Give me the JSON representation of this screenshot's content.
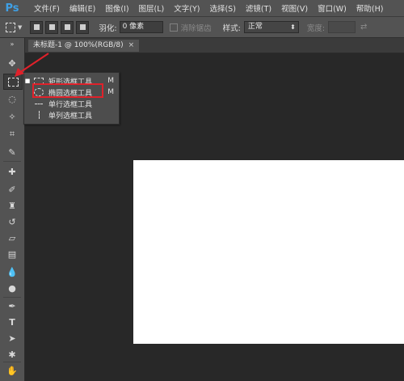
{
  "app": {
    "logo": "Ps",
    "menus": [
      "文件(F)",
      "编辑(E)",
      "图像(I)",
      "图层(L)",
      "文字(Y)",
      "选择(S)",
      "滤镜(T)",
      "视图(V)",
      "窗口(W)",
      "帮助(H)"
    ]
  },
  "options_bar": {
    "feather_label": "羽化:",
    "feather_value": "0 像素",
    "antialias_label": "消除锯齿",
    "style_label": "样式:",
    "style_value": "正常",
    "width_label": "宽度:"
  },
  "document": {
    "tab_title": "未标题-1 @ 100%(RGB/8)",
    "close_symbol": "×"
  },
  "flyout": {
    "items": [
      {
        "label": "矩形选框工具",
        "key": "M",
        "active": true,
        "icon": "rect-marquee-icon"
      },
      {
        "label": "椭圆选框工具",
        "key": "M",
        "active": false,
        "icon": "ellipse-marquee-icon"
      },
      {
        "label": "单行选框工具",
        "key": "",
        "active": false,
        "icon": "single-row-marquee-icon"
      },
      {
        "label": "单列选框工具",
        "key": "",
        "active": false,
        "icon": "single-column-marquee-icon"
      }
    ]
  },
  "colors": {
    "accent_logo": "#3fa0e5",
    "annotation_red": "#e0212a"
  }
}
